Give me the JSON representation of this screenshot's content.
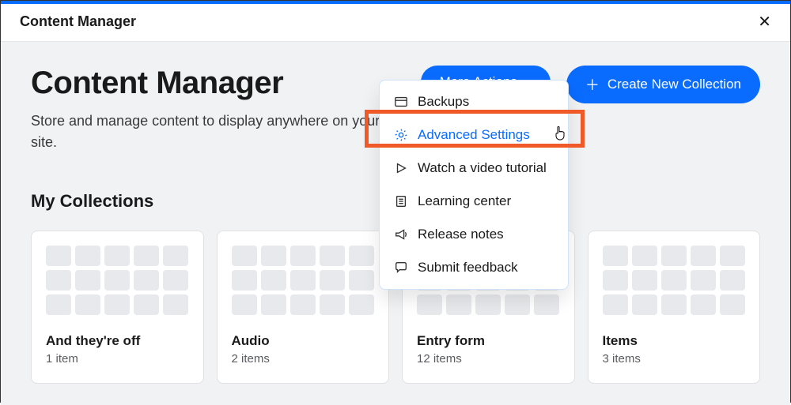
{
  "header": {
    "title": "Content Manager"
  },
  "hero": {
    "title": "Content Manager",
    "subtitle": "Store and manage content to display anywhere on your site.",
    "more_actions_label": "More Actions",
    "create_label": "Create New Collection"
  },
  "dropdown": {
    "backups": "Backups",
    "advanced": "Advanced Settings",
    "tutorial": "Watch a video tutorial",
    "learning": "Learning center",
    "release": "Release notes",
    "feedback": "Submit feedback"
  },
  "section": {
    "title": "My Collections"
  },
  "collections": [
    {
      "title": "And they're off",
      "sub": "1 item"
    },
    {
      "title": "Audio",
      "sub": "2 items"
    },
    {
      "title": "Entry form",
      "sub": "12 items"
    },
    {
      "title": "Items",
      "sub": "3 items"
    }
  ]
}
